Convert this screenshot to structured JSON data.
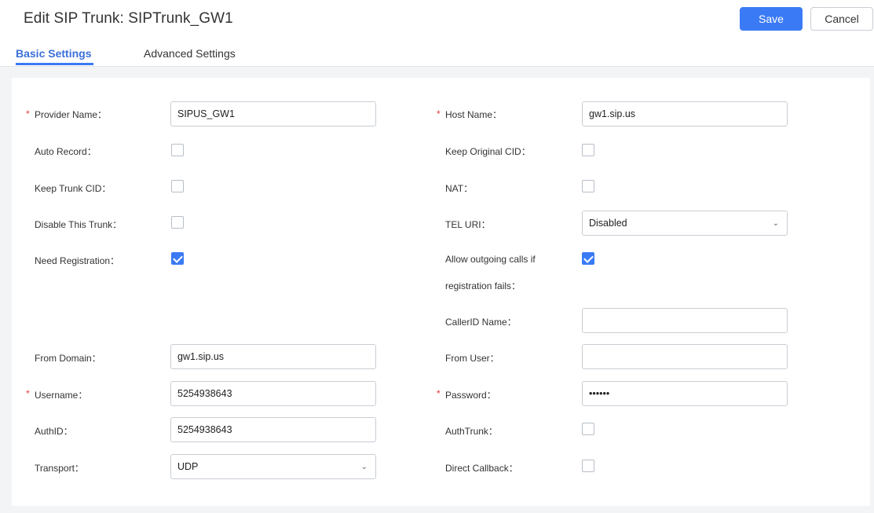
{
  "header": {
    "title": "Edit SIP Trunk: SIPTrunk_GW1",
    "save_label": "Save",
    "cancel_label": "Cancel"
  },
  "tabs": [
    {
      "label": "Basic Settings",
      "active": true
    },
    {
      "label": "Advanced Settings",
      "active": false
    }
  ],
  "form": {
    "provider_name": {
      "label": "Provider Name：",
      "value": "SIPUS_GW1"
    },
    "host_name": {
      "label": "Host Name：",
      "value": "gw1.sip.us"
    },
    "auto_record": {
      "label": "Auto Record：",
      "checked": false
    },
    "keep_original_cid": {
      "label": "Keep Original CID：",
      "checked": false
    },
    "keep_trunk_cid": {
      "label": "Keep Trunk CID：",
      "checked": false
    },
    "nat": {
      "label": "NAT：",
      "checked": false
    },
    "disable_trunk": {
      "label": "Disable This Trunk：",
      "checked": false
    },
    "tel_uri": {
      "label": "TEL URI：",
      "value": "Disabled"
    },
    "need_registration": {
      "label": "Need Registration：",
      "checked": true
    },
    "allow_outgoing": {
      "label_line1": "Allow outgoing calls if",
      "label_line2": "registration fails：",
      "checked": true
    },
    "callerid_name": {
      "label": "CallerID Name：",
      "value": ""
    },
    "from_domain": {
      "label": "From Domain：",
      "value": "gw1.sip.us"
    },
    "from_user": {
      "label": "From User：",
      "value": ""
    },
    "username": {
      "label": "Username：",
      "value": "5254938643"
    },
    "password": {
      "label": "Password：",
      "value": "••••••"
    },
    "authid": {
      "label": "AuthID：",
      "value": "5254938643"
    },
    "authtrunk": {
      "label": "AuthTrunk：",
      "checked": false
    },
    "transport": {
      "label": "Transport：",
      "value": "UDP"
    },
    "direct_callback": {
      "label": "Direct Callback：",
      "checked": false
    }
  },
  "required_marker": "*",
  "icons": {
    "chevron": "chevron-down-icon",
    "check": "check-icon"
  },
  "colors": {
    "accent": "#3b7af5",
    "required": "#e53935"
  }
}
